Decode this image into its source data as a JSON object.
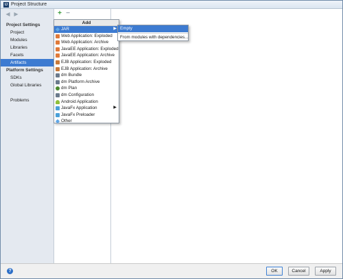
{
  "window": {
    "title": "Project Structure",
    "icon": "intellij-icon"
  },
  "sidebar": {
    "sections": [
      {
        "label": "Project Settings",
        "items": [
          "Project",
          "Modules",
          "Libraries",
          "Facets",
          "Artifacts"
        ]
      },
      {
        "label": "Platform Settings",
        "items": [
          "SDKs",
          "Global Libraries"
        ]
      },
      {
        "label": "",
        "items": [
          "Problems"
        ]
      }
    ],
    "selected": "Artifacts"
  },
  "toolbar": {
    "add_glyph": "+",
    "remove_glyph": "−"
  },
  "add_menu": {
    "header": "Add",
    "items": [
      {
        "label": "JAR",
        "icon": "diamond-icon",
        "has_submenu": true,
        "active": true
      },
      {
        "label": "Web Application: Exploded",
        "icon": "web-icon"
      },
      {
        "label": "Web Application: Archive",
        "icon": "web-icon"
      },
      {
        "label": "JavaEE Application: Exploded",
        "icon": "web-icon"
      },
      {
        "label": "JavaEE Application: Archive",
        "icon": "web-icon"
      },
      {
        "label": "EJB Application: Exploded",
        "icon": "ejb-icon"
      },
      {
        "label": "EJB Application: Archive",
        "icon": "ejb-icon"
      },
      {
        "label": "dm Bundle",
        "icon": "dm-icon"
      },
      {
        "label": "dm Platform Archive",
        "icon": "dm-icon"
      },
      {
        "label": "dm Plan",
        "icon": "dm-plan-icon"
      },
      {
        "label": "dm Configuration",
        "icon": "dm-icon"
      },
      {
        "label": "Android Application",
        "icon": "android-icon"
      },
      {
        "label": "JavaFx Application",
        "icon": "javafx-icon",
        "has_submenu": true
      },
      {
        "label": "JavaFx Preloader",
        "icon": "javafx-icon"
      },
      {
        "label": "Other",
        "icon": "diamond-icon"
      }
    ]
  },
  "jar_submenu": {
    "items": [
      "Empty",
      "From modules with dependencies..."
    ],
    "active": "Empty"
  },
  "buttons": {
    "ok": "OK",
    "cancel": "Cancel",
    "apply": "Apply"
  },
  "colors": {
    "selection": "#3d7bd1",
    "add_green": "#3a9a3a",
    "help_blue": "#2d6fc7"
  }
}
